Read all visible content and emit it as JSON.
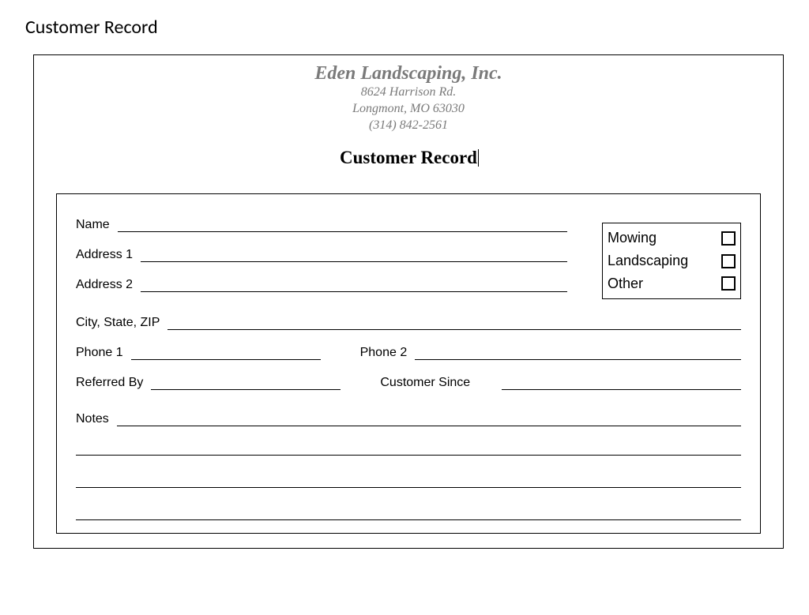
{
  "page_heading": "Customer Record",
  "letterhead": {
    "company": "Eden Landscaping, Inc.",
    "street": "8624 Harrison Rd.",
    "city_state_zip": "Longmont, MO 63030",
    "phone": "(314) 842-2561"
  },
  "form_title": "Customer Record",
  "fields": {
    "name_label": "Name",
    "address1_label": "Address 1",
    "address2_label": "Address 2",
    "city_state_zip_label": "City, State, ZIP",
    "phone1_label": "Phone 1",
    "phone2_label": "Phone 2",
    "referred_by_label": "Referred By",
    "customer_since_label": "Customer Since",
    "notes_label": "Notes"
  },
  "service_options": {
    "mowing": "Mowing",
    "landscaping": "Landscaping",
    "other": "Other"
  }
}
